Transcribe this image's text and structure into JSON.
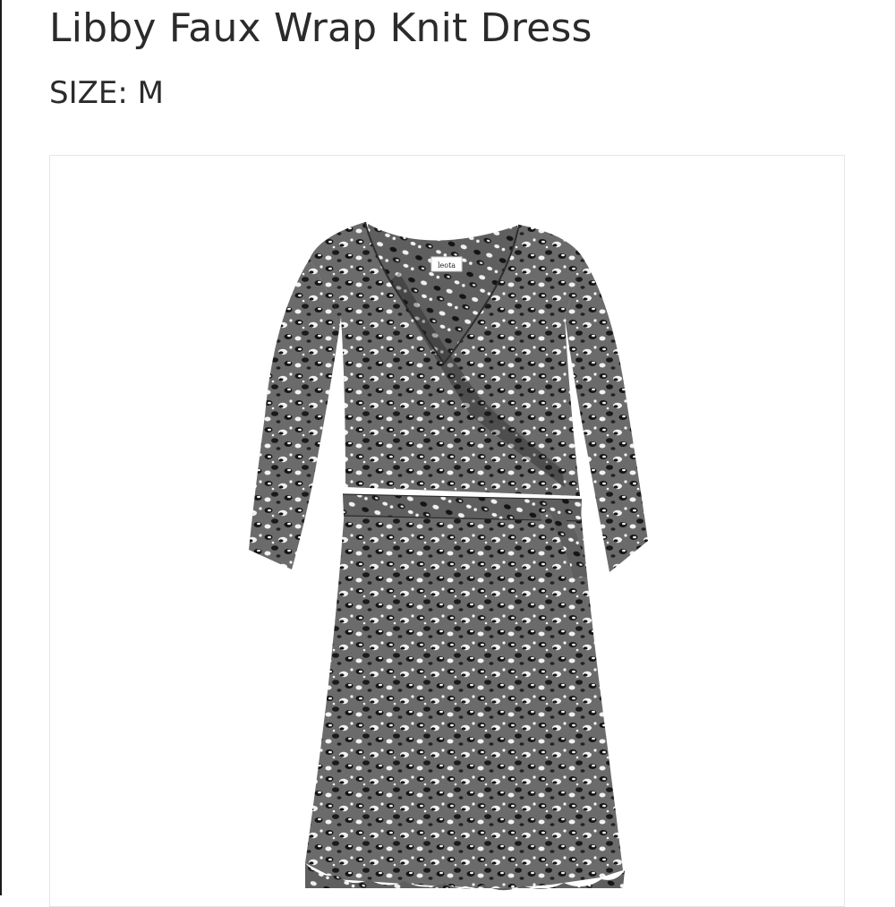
{
  "product": {
    "title": "Libby Faux Wrap Knit Dress",
    "size_label": "SIZE:",
    "size_value": "M"
  },
  "image": {
    "label_tag": "leota",
    "icon": "dress-photo"
  },
  "colors": {
    "text": "#2b2b2b",
    "card_border": "#e6e6e6",
    "dress_base": "#6b6b6b",
    "spot_dark": "#151515",
    "spot_light": "#f2f2f2"
  }
}
